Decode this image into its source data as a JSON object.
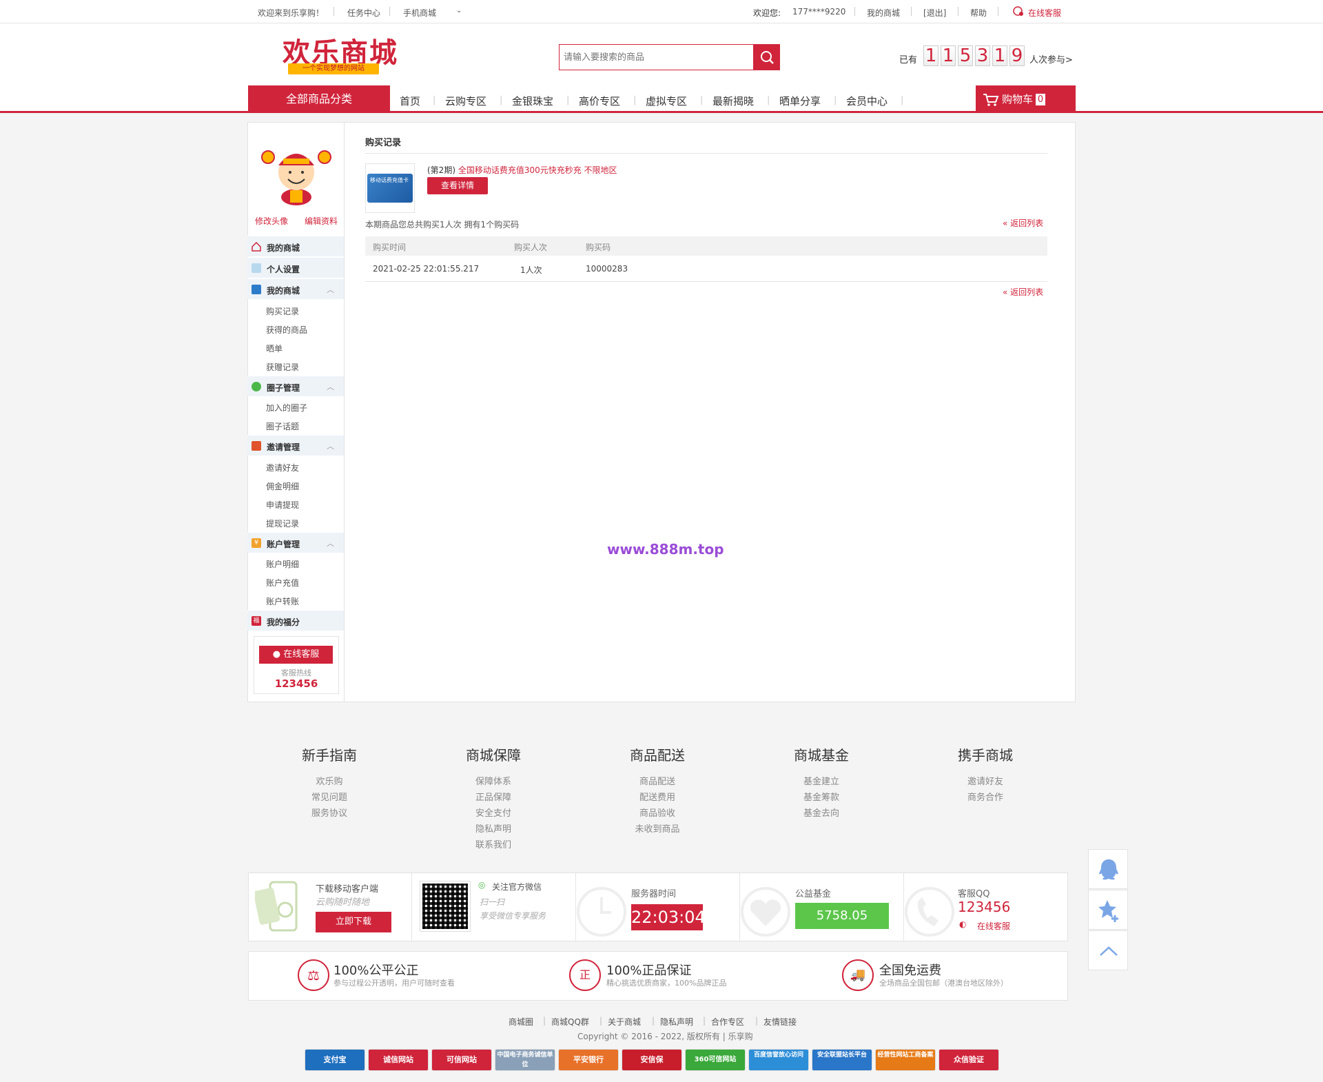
{
  "topbar": {
    "welcome": "欢迎来到乐享购！",
    "task_center": "任务中心",
    "mobile_mall": "手机商城",
    "greeting": "欢迎您:",
    "username": "177****9220",
    "my_mall": "我的商城",
    "logout": "[退出]",
    "help": "帮助",
    "online_service": "在线客服"
  },
  "header": {
    "logo": "欢乐商城",
    "slogan": "一个实现梦想的网站",
    "search_placeholder": "请输入要搜索的商品",
    "counter_prefix": "已有",
    "counter_digits": [
      "1",
      "1",
      "5",
      "3",
      "1",
      "9"
    ],
    "counter_suffix": "人次参与>"
  },
  "nav": {
    "all_categories": "全部商品分类",
    "items": [
      "首页",
      "云购专区",
      "金银珠宝",
      "高价专区",
      "虚拟专区",
      "最新揭晓",
      "晒单分享",
      "会员中心"
    ],
    "cart_label": "购物车",
    "cart_count": "0"
  },
  "sidebar": {
    "edit_avatar": "修改头像",
    "edit_profile": "编辑资料",
    "menus": [
      {
        "label": "我的商城"
      },
      {
        "label": "个人设置"
      },
      {
        "label": "我的商城",
        "subs": [
          "购买记录",
          "获得的商品",
          "晒单",
          "获赠记录"
        ]
      },
      {
        "label": "圈子管理",
        "subs": [
          "加入的圈子",
          "圈子话题"
        ]
      },
      {
        "label": "邀请管理",
        "subs": [
          "邀请好友",
          "佣金明细",
          "申请提现",
          "提现记录"
        ]
      },
      {
        "label": "账户管理",
        "subs": [
          "账户明细",
          "账户充值",
          "账户转账"
        ]
      },
      {
        "label": "我的福分"
      }
    ],
    "service_btn": "在线客服",
    "hotline_label": "客服热线",
    "hotline": "123456"
  },
  "content": {
    "title": "购买记录",
    "product_period": "(第2期)",
    "product_name": "全国移动话费充值300元快充秒充 不限地区",
    "product_card_text": "移动话费充值卡",
    "detail_btn": "查看详情",
    "summary": "本期商品您总共购买1人次 拥有1个购买码",
    "back_link": "返回列表",
    "table": {
      "headers": [
        "购买时间",
        "购买人次",
        "购买码"
      ],
      "rows": [
        [
          "2021-02-25 22:01:55.217",
          "1人次",
          "10000283"
        ]
      ]
    },
    "watermark": "www.888m.top"
  },
  "footer": {
    "columns": [
      {
        "title": "新手指南",
        "links": [
          "欢乐购",
          "常见问题",
          "服务协议"
        ]
      },
      {
        "title": "商城保障",
        "links": [
          "保障体系",
          "正品保障",
          "安全支付",
          "隐私声明",
          "联系我们"
        ]
      },
      {
        "title": "商品配送",
        "links": [
          "商品配送",
          "配送费用",
          "商品验收",
          "未收到商品"
        ]
      },
      {
        "title": "商城基金",
        "links": [
          "基金建立",
          "基金筹款",
          "基金去向"
        ]
      },
      {
        "title": "携手商城",
        "links": [
          "邀请好友",
          "商务合作"
        ]
      }
    ],
    "service": {
      "download_title": "下载移动客户端",
      "download_sub": "云购随时随地",
      "download_btn": "立即下载",
      "wechat_title": "关注官方微信",
      "wechat_sub1": "扫一扫",
      "wechat_sub2": "享受微信专享服务",
      "server_time_label": "服务器时间",
      "server_time": "22:03:04",
      "fund_label": "公益基金",
      "fund_value": "5758.05",
      "qq_label": "客服QQ",
      "qq_value": "123456",
      "qq_online": "在线客服"
    },
    "guarantees": [
      {
        "title": "100%公平公正",
        "sub": "参与过程公开透明，用户可随时查看"
      },
      {
        "title": "100%正品保证",
        "sub": "精心挑选优质商家，100%品牌正品"
      },
      {
        "title": "全国免运费",
        "sub": "全场商品全国包邮（港澳台地区除外）"
      }
    ],
    "bottom_links": [
      "商城圈",
      "商城QQ群",
      "关于商城",
      "隐私声明",
      "合作专区",
      "友情链接"
    ],
    "copyright": "Copyright © 2016 - 2022, 版权所有 | 乐享购",
    "badges": [
      {
        "text": "支付宝",
        "color": "#1f6fbf"
      },
      {
        "text": "诚信网站",
        "color": "#d0243b"
      },
      {
        "text": "可信网站",
        "color": "#d0243b"
      },
      {
        "text": "中国电子商务诚信单位",
        "color": "#8aa0b8"
      },
      {
        "text": "平安银行",
        "color": "#e8712a"
      },
      {
        "text": "安信保",
        "color": "#c81e2c"
      },
      {
        "text": "360可信网站",
        "color": "#3aa83a"
      },
      {
        "text": "百度信誉放心访问",
        "color": "#2d8ed8"
      },
      {
        "text": "安全联盟站长平台",
        "color": "#2a76c9"
      },
      {
        "text": "经营性网站工商备案",
        "color": "#e67a16"
      },
      {
        "text": "众信验证",
        "color": "#d0243b"
      }
    ]
  },
  "colors": {
    "brand": "#d0243b",
    "fund_green": "#5bc64a",
    "watermark": "#9a4cd6"
  }
}
